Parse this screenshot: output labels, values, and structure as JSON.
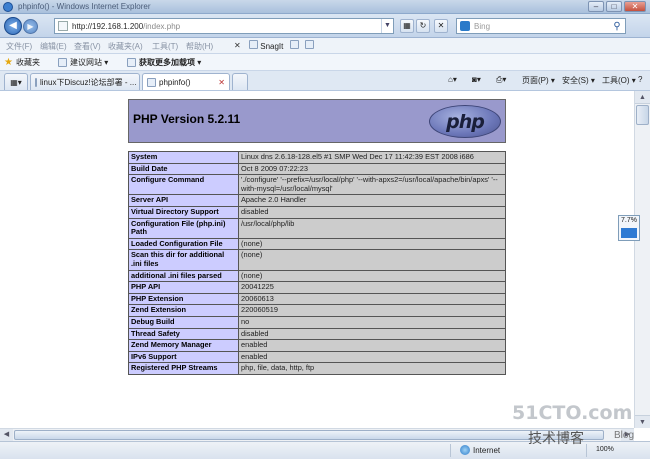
{
  "window": {
    "title": "phpinfo() - Windows Internet Explorer",
    "buttons": {
      "minimize": "–",
      "maximize": "□",
      "close": "✕"
    }
  },
  "address_bar": {
    "url_host": "http://192.168.1.200",
    "url_path": "/index.php",
    "search_placeholder": "Bing"
  },
  "menu": {
    "items": [
      "文件(F)",
      "编辑(E)",
      "查看(V)",
      "收藏夹(A)",
      "工具(T)",
      "帮助(H)"
    ],
    "snagit": "SnagIt"
  },
  "favorites": {
    "label": "收藏夹",
    "items": [
      "建议网站 ▾",
      "获取更多加载项 ▾"
    ]
  },
  "tabs": [
    {
      "label": "linux下Discuz!论坛部署 - ..."
    },
    {
      "label": "phpinfo()"
    }
  ],
  "command_bar": {
    "page": "页面(P) ▾",
    "safety": "安全(S) ▾",
    "tools": "工具(O) ▾",
    "help": "❓ ▾"
  },
  "php": {
    "version_title": "PHP Version 5.2.11",
    "logo_text": "php",
    "rows": [
      {
        "key": "System",
        "value": "Linux dns 2.6.18-128.el5 #1 SMP Wed Dec 17 11:42:39 EST 2008 i686"
      },
      {
        "key": "Build Date",
        "value": "Oct 8 2009 07:22:23"
      },
      {
        "key": "Configure Command",
        "value": "'./configure' '--prefix=/usr/local/php' '--with-apxs2=/usr/local/apache/bin/apxs' '--with-mysql=/usr/local/mysql'"
      },
      {
        "key": "Server API",
        "value": "Apache 2.0 Handler"
      },
      {
        "key": "Virtual Directory Support",
        "value": "disabled"
      },
      {
        "key": "Configuration File (php.ini) Path",
        "value": "/usr/local/php/lib"
      },
      {
        "key": "Loaded Configuration File",
        "value": "(none)"
      },
      {
        "key": "Scan this dir for additional .ini files",
        "value": "(none)"
      },
      {
        "key": "additional .ini files parsed",
        "value": "(none)"
      },
      {
        "key": "PHP API",
        "value": "20041225"
      },
      {
        "key": "PHP Extension",
        "value": "20060613"
      },
      {
        "key": "Zend Extension",
        "value": "220060519"
      },
      {
        "key": "Debug Build",
        "value": "no"
      },
      {
        "key": "Thread Safety",
        "value": "disabled"
      },
      {
        "key": "Zend Memory Manager",
        "value": "enabled"
      },
      {
        "key": "IPv6 Support",
        "value": "enabled"
      },
      {
        "key": "Registered PHP Streams",
        "value": "php, file, data, http, ftp"
      }
    ]
  },
  "side_badge": {
    "text": "7.7%",
    "fraction": 0.077
  },
  "statusbar": {
    "zone": "Internet",
    "zoom": "100%"
  },
  "watermark": {
    "site": "51CTO.com",
    "cn": "技术博客",
    "blog": "Blog"
  }
}
